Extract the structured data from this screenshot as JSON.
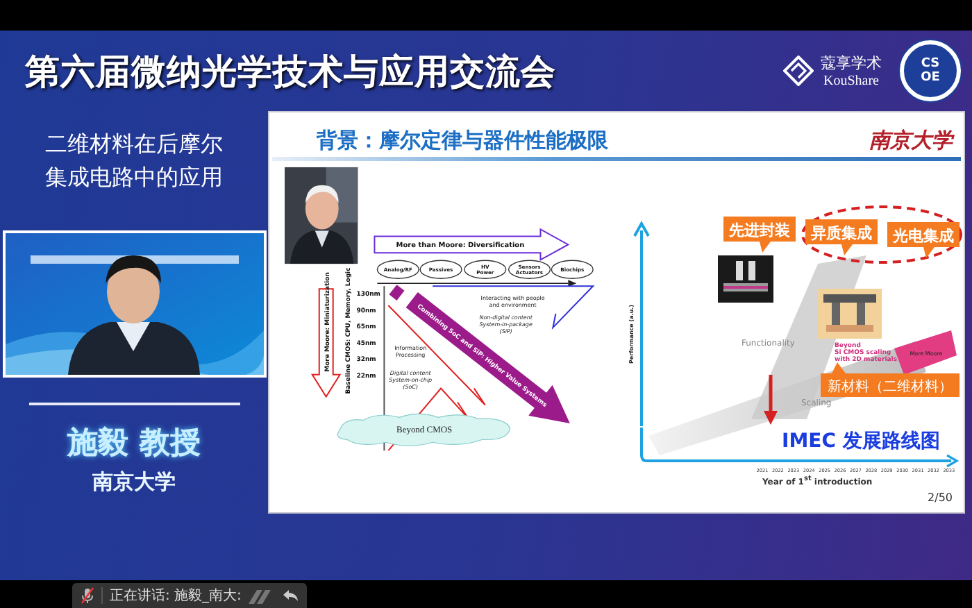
{
  "header": {
    "title": "第六届微纳光学技术与应用交流会",
    "brand_cn": "蔻享学术",
    "brand_en": "KouShare",
    "emblem_letters": [
      "CS",
      "OE"
    ]
  },
  "talk": {
    "subtitle_lines": [
      "二维材料在后摩尔",
      "集成电路中的应用"
    ],
    "video": {
      "kind": "picture"
    },
    "speaker": "施毅 教授",
    "affiliation": "南京大学"
  },
  "slide": {
    "title": "背景：摩尔定律与器件性能极限",
    "logo_text": "南京大学",
    "moore_diagram": {
      "diversification": "More than Moore: Diversification",
      "categories": [
        [
          "Analog/RF"
        ],
        [
          "Passives"
        ],
        [
          "HV",
          "Power"
        ],
        [
          "Sensors",
          "Actuators"
        ],
        [
          "Biochips"
        ]
      ],
      "nodes": [
        "130nm",
        "90nm",
        "65nm",
        "45nm",
        "32nm",
        "22nm"
      ],
      "miniaturization": "More Moore: Miniaturization",
      "baseline": "Baseline CMOS: CPU, Memory, Logic",
      "interacting_lines": [
        "Interacting with people",
        "and environment"
      ],
      "sip_lines": [
        "Non-digital content",
        "System-in-package",
        "(SiP)"
      ],
      "info_lines": [
        "Information",
        "Processing"
      ],
      "soc_lines": [
        "Digital content",
        "System-on-chip",
        "(SoC)"
      ],
      "combining": "Combining SoC and SiP: Higher Value Systems",
      "beyond": "Beyond CMOS"
    },
    "roadmap": {
      "callouts": [
        "先进封装",
        "异质集成",
        "光电集成"
      ],
      "new_material": "新材料（二维材料）",
      "title": "IMEC 发展路线图",
      "y_axis": "Performance (a.u.)",
      "x_axis": "Year of 1$^{st}$ introduction",
      "functionality": "Functionality",
      "scaling": "Scaling",
      "more_moore": "More Moore",
      "beyond_lines": [
        "Beyond",
        "Si CMOS scaling",
        "with 2D materials"
      ],
      "years": [
        "2021",
        "2022",
        "2023",
        "2024",
        "2025",
        "2026",
        "2027",
        "2028",
        "2029",
        "2030",
        "2031",
        "2032",
        "2033"
      ]
    },
    "page": "2/50"
  },
  "status": {
    "speaking_label": "正在讲话: 施毅_南大:",
    "mic_muted": true
  }
}
